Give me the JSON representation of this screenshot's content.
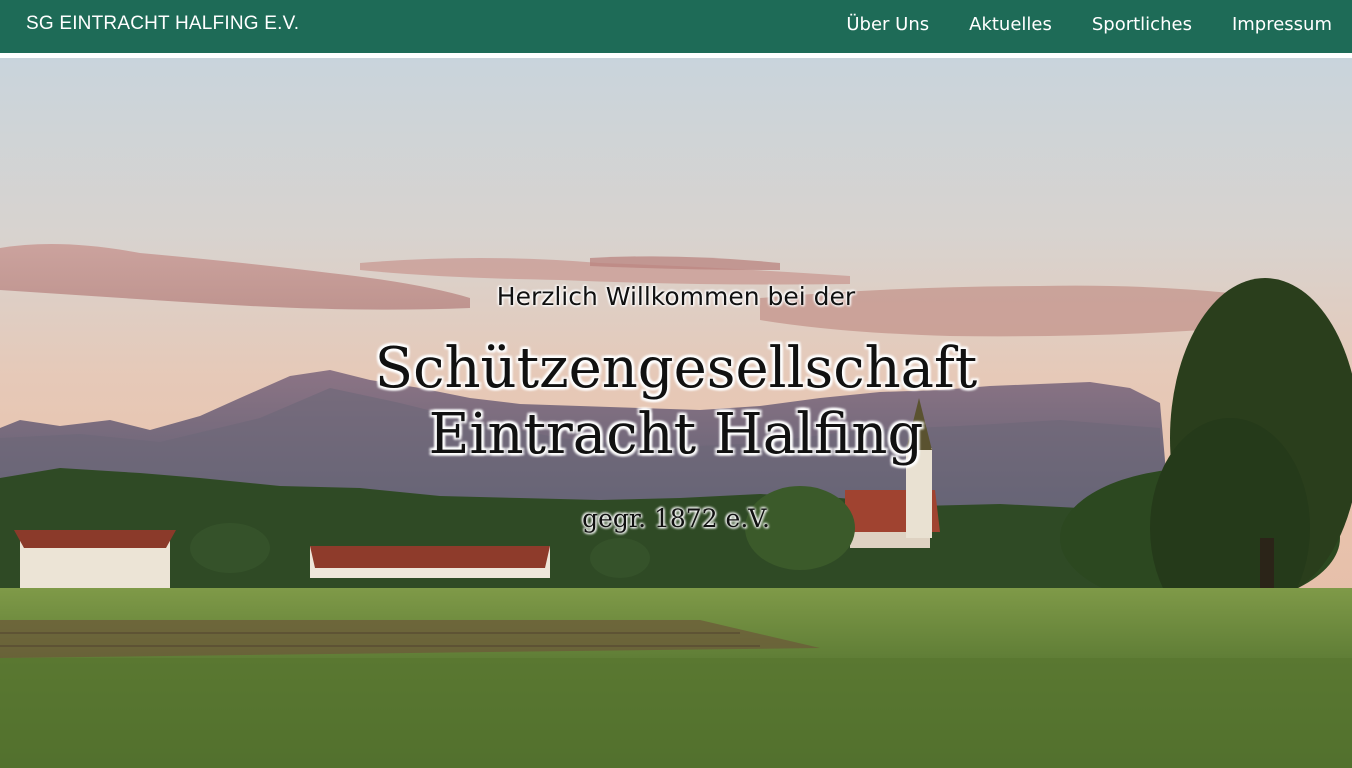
{
  "header": {
    "brand": "SG EINTRACHT HALFING E.V.",
    "nav": [
      {
        "label": "Über Uns"
      },
      {
        "label": "Aktuelles"
      },
      {
        "label": "Sportliches"
      },
      {
        "label": "Impressum"
      }
    ]
  },
  "hero": {
    "welcome": "Herzlich Willkommen bei der",
    "name_line1": "Schützengesellschaft",
    "name_line2": "Eintracht Halfing",
    "founded": "gegr. 1872 e.V."
  },
  "colors": {
    "navbar": "#1e6b57",
    "text": "#111111"
  }
}
